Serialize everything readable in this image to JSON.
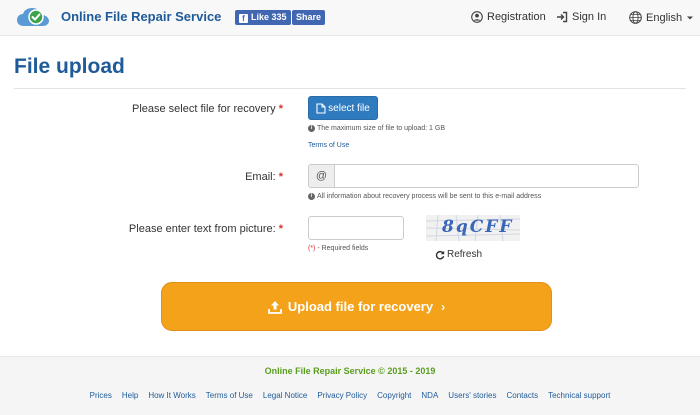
{
  "header": {
    "brand": "Online File Repair Service",
    "fb_like_label": "Like",
    "fb_like_count": "335",
    "fb_share_label": "Share",
    "registration": "Registration",
    "sign_in": "Sign In",
    "language": "English",
    "icons": {
      "logo": "cloud-check-icon",
      "registration": "user-circle-icon",
      "sign_in": "sign-in-icon",
      "language": "globe-icon",
      "language_caret": "caret-down-icon"
    }
  },
  "page": {
    "title": "File upload"
  },
  "form": {
    "file": {
      "label": "Please select file for recovery",
      "button": "select file",
      "hint": "The maximum size of file to upload: 1 GB",
      "terms_link": "Terms of Use"
    },
    "email": {
      "label": "Email:",
      "addon": "@",
      "value": "",
      "hint": "All information about recovery process will be sent to this e-mail address"
    },
    "captcha": {
      "label": "Please enter text from picture:",
      "value": "",
      "image_text": "8qCFF",
      "refresh": "Refresh",
      "required_star": "(*)",
      "required_text": " - Required fields"
    },
    "required_marker": "*",
    "submit": "Upload file for recovery",
    "submit_chevron": "›"
  },
  "footer": {
    "copyright": "Online File Repair Service © 2015 - 2019",
    "links": [
      "Prices",
      "Help",
      "How It Works",
      "Terms of Use",
      "Legal Notice",
      "Privacy Policy",
      "Copyright",
      "NDA",
      "Users' stories",
      "Contacts",
      "Technical support"
    ]
  },
  "colors": {
    "brand_blue": "#1f5a99",
    "primary_button": "#2f7bc0",
    "upload_orange": "#f3a21a",
    "required_red": "#d9302c",
    "copyright_green": "#5a9e1f",
    "facebook_blue": "#4267b2"
  }
}
